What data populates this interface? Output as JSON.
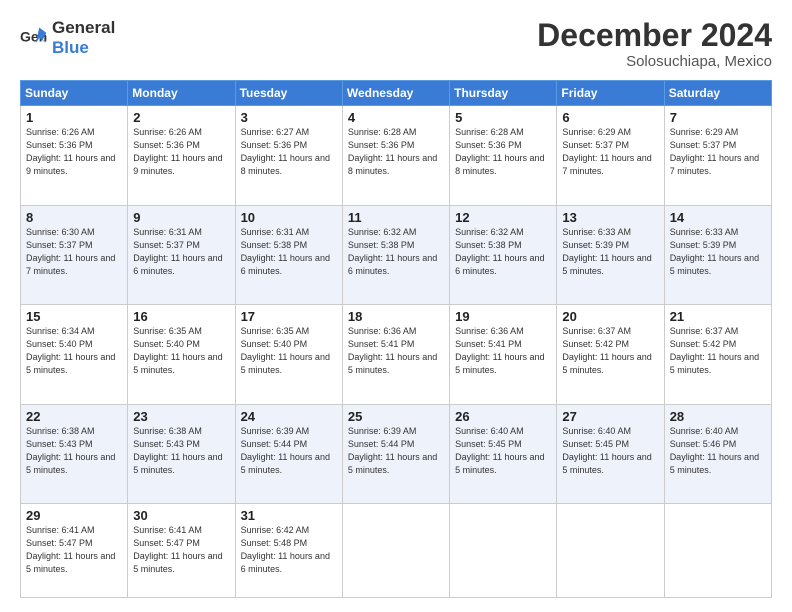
{
  "logo": {
    "text_general": "General",
    "text_blue": "Blue"
  },
  "header": {
    "month_year": "December 2024",
    "location": "Solosuchiapa, Mexico"
  },
  "days_of_week": [
    "Sunday",
    "Monday",
    "Tuesday",
    "Wednesday",
    "Thursday",
    "Friday",
    "Saturday"
  ],
  "weeks": [
    [
      {
        "day": "1",
        "sunrise": "6:26 AM",
        "sunset": "5:36 PM",
        "daylight": "11 hours and 9 minutes."
      },
      {
        "day": "2",
        "sunrise": "6:26 AM",
        "sunset": "5:36 PM",
        "daylight": "11 hours and 9 minutes."
      },
      {
        "day": "3",
        "sunrise": "6:27 AM",
        "sunset": "5:36 PM",
        "daylight": "11 hours and 8 minutes."
      },
      {
        "day": "4",
        "sunrise": "6:28 AM",
        "sunset": "5:36 PM",
        "daylight": "11 hours and 8 minutes."
      },
      {
        "day": "5",
        "sunrise": "6:28 AM",
        "sunset": "5:36 PM",
        "daylight": "11 hours and 8 minutes."
      },
      {
        "day": "6",
        "sunrise": "6:29 AM",
        "sunset": "5:37 PM",
        "daylight": "11 hours and 7 minutes."
      },
      {
        "day": "7",
        "sunrise": "6:29 AM",
        "sunset": "5:37 PM",
        "daylight": "11 hours and 7 minutes."
      }
    ],
    [
      {
        "day": "8",
        "sunrise": "6:30 AM",
        "sunset": "5:37 PM",
        "daylight": "11 hours and 7 minutes."
      },
      {
        "day": "9",
        "sunrise": "6:31 AM",
        "sunset": "5:37 PM",
        "daylight": "11 hours and 6 minutes."
      },
      {
        "day": "10",
        "sunrise": "6:31 AM",
        "sunset": "5:38 PM",
        "daylight": "11 hours and 6 minutes."
      },
      {
        "day": "11",
        "sunrise": "6:32 AM",
        "sunset": "5:38 PM",
        "daylight": "11 hours and 6 minutes."
      },
      {
        "day": "12",
        "sunrise": "6:32 AM",
        "sunset": "5:38 PM",
        "daylight": "11 hours and 6 minutes."
      },
      {
        "day": "13",
        "sunrise": "6:33 AM",
        "sunset": "5:39 PM",
        "daylight": "11 hours and 5 minutes."
      },
      {
        "day": "14",
        "sunrise": "6:33 AM",
        "sunset": "5:39 PM",
        "daylight": "11 hours and 5 minutes."
      }
    ],
    [
      {
        "day": "15",
        "sunrise": "6:34 AM",
        "sunset": "5:40 PM",
        "daylight": "11 hours and 5 minutes."
      },
      {
        "day": "16",
        "sunrise": "6:35 AM",
        "sunset": "5:40 PM",
        "daylight": "11 hours and 5 minutes."
      },
      {
        "day": "17",
        "sunrise": "6:35 AM",
        "sunset": "5:40 PM",
        "daylight": "11 hours and 5 minutes."
      },
      {
        "day": "18",
        "sunrise": "6:36 AM",
        "sunset": "5:41 PM",
        "daylight": "11 hours and 5 minutes."
      },
      {
        "day": "19",
        "sunrise": "6:36 AM",
        "sunset": "5:41 PM",
        "daylight": "11 hours and 5 minutes."
      },
      {
        "day": "20",
        "sunrise": "6:37 AM",
        "sunset": "5:42 PM",
        "daylight": "11 hours and 5 minutes."
      },
      {
        "day": "21",
        "sunrise": "6:37 AM",
        "sunset": "5:42 PM",
        "daylight": "11 hours and 5 minutes."
      }
    ],
    [
      {
        "day": "22",
        "sunrise": "6:38 AM",
        "sunset": "5:43 PM",
        "daylight": "11 hours and 5 minutes."
      },
      {
        "day": "23",
        "sunrise": "6:38 AM",
        "sunset": "5:43 PM",
        "daylight": "11 hours and 5 minutes."
      },
      {
        "day": "24",
        "sunrise": "6:39 AM",
        "sunset": "5:44 PM",
        "daylight": "11 hours and 5 minutes."
      },
      {
        "day": "25",
        "sunrise": "6:39 AM",
        "sunset": "5:44 PM",
        "daylight": "11 hours and 5 minutes."
      },
      {
        "day": "26",
        "sunrise": "6:40 AM",
        "sunset": "5:45 PM",
        "daylight": "11 hours and 5 minutes."
      },
      {
        "day": "27",
        "sunrise": "6:40 AM",
        "sunset": "5:45 PM",
        "daylight": "11 hours and 5 minutes."
      },
      {
        "day": "28",
        "sunrise": "6:40 AM",
        "sunset": "5:46 PM",
        "daylight": "11 hours and 5 minutes."
      }
    ],
    [
      {
        "day": "29",
        "sunrise": "6:41 AM",
        "sunset": "5:47 PM",
        "daylight": "11 hours and 5 minutes."
      },
      {
        "day": "30",
        "sunrise": "6:41 AM",
        "sunset": "5:47 PM",
        "daylight": "11 hours and 5 minutes."
      },
      {
        "day": "31",
        "sunrise": "6:42 AM",
        "sunset": "5:48 PM",
        "daylight": "11 hours and 6 minutes."
      },
      null,
      null,
      null,
      null
    ]
  ]
}
